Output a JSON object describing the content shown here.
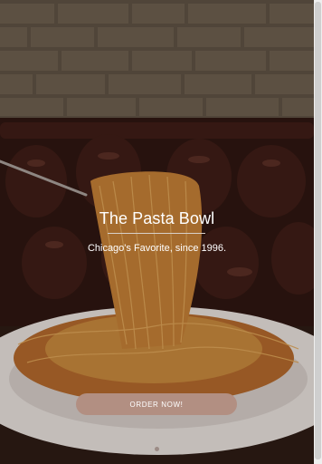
{
  "hero": {
    "title": "The Pasta Bowl",
    "subtitle": "Chicago's Favorite, since 1996.",
    "cta_label": "ORDER NOW!",
    "image_icon": "pasta-photo"
  },
  "colors": {
    "cta_background": "#b28f82",
    "text": "#ffffff"
  }
}
